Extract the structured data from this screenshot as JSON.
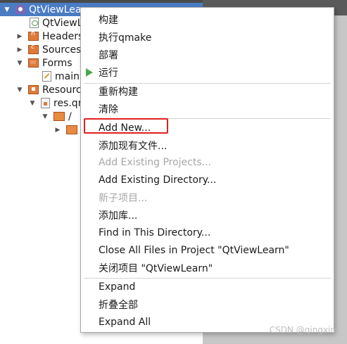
{
  "tree": {
    "project": "QtViewLearn",
    "items": [
      {
        "label": "QtViewLearn.pro"
      },
      {
        "label": "Headers"
      },
      {
        "label": "Sources"
      },
      {
        "label": "Forms"
      },
      {
        "label": "mainwindow.ui"
      },
      {
        "label": "Resources"
      },
      {
        "label": "res.qrc"
      },
      {
        "label": "/"
      },
      {
        "label": ""
      }
    ]
  },
  "menu": {
    "items": [
      {
        "label": "构建"
      },
      {
        "label": "执行qmake"
      },
      {
        "label": "部署"
      },
      {
        "label": "运行"
      },
      {
        "label": "重新构建"
      },
      {
        "label": "清除"
      },
      {
        "label": "Add New..."
      },
      {
        "label": "添加现有文件..."
      },
      {
        "label": "Add Existing Projects..."
      },
      {
        "label": "Add Existing Directory..."
      },
      {
        "label": "新子项目..."
      },
      {
        "label": "添加库..."
      },
      {
        "label": "Find in This Directory..."
      },
      {
        "label": "Close All Files in Project \"QtViewLearn\""
      },
      {
        "label": "关闭项目 \"QtViewLearn\""
      },
      {
        "label": "Expand"
      },
      {
        "label": "折叠全部"
      },
      {
        "label": "Expand All"
      }
    ]
  },
  "watermark": "CSDN @qingxin_",
  "colors": {
    "selection": "#4a7cc4",
    "highlight_box": "#e02020",
    "run_icon": "#4aa84a"
  }
}
